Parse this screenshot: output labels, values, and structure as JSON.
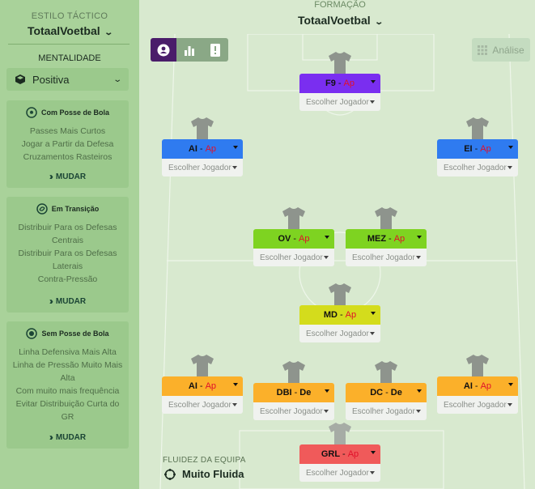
{
  "sidebar": {
    "title": "ESTILO TÁCTICO",
    "style_name": "TotaalVoetbal",
    "mentality_label": "MENTALIDADE",
    "mentality_value": "Positiva",
    "cards": [
      {
        "title": "Com Posse de Bola",
        "icon": "ball-icon",
        "lines": [
          "Passes Mais Curtos",
          "Jogar a Partir da Defesa",
          "Cruzamentos Rasteiros"
        ],
        "button": "MUDAR"
      },
      {
        "title": "Em Transição",
        "icon": "transition-icon",
        "lines": [
          "Distribuir Para os Defesas",
          "Centrais",
          "Distribuir Para os Defesas",
          "Laterais",
          "Contra-Pressão"
        ],
        "button": "MUDAR"
      },
      {
        "title": "Sem Posse de Bola",
        "icon": "no-ball-icon",
        "lines": [
          "Linha Defensiva Mais Alta",
          "Linha de Pressão Muito Mais",
          "Alta",
          "Com muito mais frequência",
          "Evitar Distribuição Curta do",
          "GR"
        ],
        "button": "MUDAR"
      }
    ]
  },
  "header": {
    "formation_label": "FORMAÇÃO",
    "formation_value": "TotaalVoetbal"
  },
  "toolbar": {
    "analysis_label": "Análise"
  },
  "players": [
    {
      "pos": "F9",
      "role": "Ap",
      "choose": "Escolher Jogador",
      "color": "#7a2ef0"
    },
    {
      "pos": "AI",
      "role": "Ap",
      "choose": "Escolher Jogador",
      "color": "#2f7bf0"
    },
    {
      "pos": "EI",
      "role": "Ap",
      "choose": "Escolher Jogador",
      "color": "#2f7bf0"
    },
    {
      "pos": "OV",
      "role": "Ap",
      "choose": "Escolher Jogador",
      "color": "#7ed321"
    },
    {
      "pos": "MEZ",
      "role": "Ap",
      "choose": "Escolher Jogador",
      "color": "#7ed321"
    },
    {
      "pos": "MD",
      "role": "Ap",
      "choose": "Escolher Jogador",
      "color": "#d4dc1c"
    },
    {
      "pos": "AI",
      "role": "Ap",
      "choose": "Escolher Jogador",
      "color": "#fbb02a"
    },
    {
      "pos": "DBI",
      "role": "De",
      "choose": "Escolher Jogador",
      "color": "#fbb02a"
    },
    {
      "pos": "DC",
      "role": "De",
      "choose": "Escolher Jogador",
      "color": "#fbb02a"
    },
    {
      "pos": "AI",
      "role": "Ap",
      "choose": "Escolher Jogador",
      "color": "#fbb02a"
    },
    {
      "pos": "GRL",
      "role": "Ap",
      "choose": "Escolher Jogador",
      "color": "#f05a5a"
    }
  ],
  "fluidity": {
    "label": "FLUIDEZ DA EQUIPA",
    "value": "Muito Fluida"
  },
  "colors": {
    "sidebar_bg": "#a9d29a",
    "pitch_bg": "#d8e9cf",
    "role_text": "#e0102a",
    "active_tab": "#4a1d6a"
  }
}
